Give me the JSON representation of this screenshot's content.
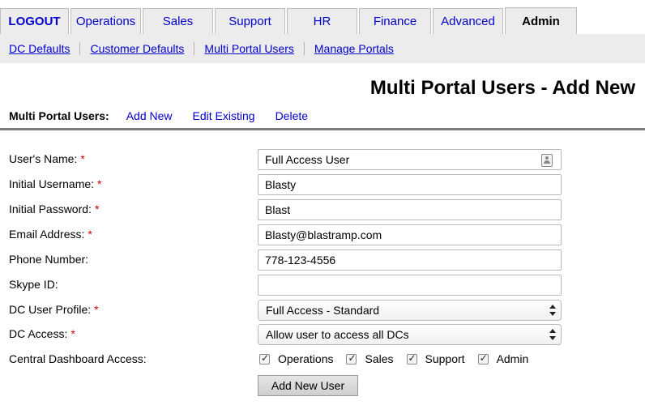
{
  "tabs": [
    {
      "label": "LOGOUT"
    },
    {
      "label": "Operations"
    },
    {
      "label": "Sales"
    },
    {
      "label": "Support"
    },
    {
      "label": "HR"
    },
    {
      "label": "Finance"
    },
    {
      "label": "Advanced"
    },
    {
      "label": "Admin",
      "active": true
    }
  ],
  "subnav": [
    {
      "label": "DC Defaults"
    },
    {
      "label": "Customer Defaults"
    },
    {
      "label": "Multi Portal Users"
    },
    {
      "label": "Manage Portals"
    }
  ],
  "page_title": "Multi Portal Users - Add New",
  "actionbar": {
    "label": "Multi Portal Users:",
    "links": [
      "Add New",
      "Edit Existing",
      "Delete"
    ]
  },
  "form": {
    "fields": [
      {
        "label": "User's Name:",
        "required": "*",
        "value": "Full Access User"
      },
      {
        "label": "Initial Username:",
        "required": "*",
        "value": "Blasty"
      },
      {
        "label": "Initial Password:",
        "required": "*",
        "value": "Blast"
      },
      {
        "label": "Email Address:",
        "required": "*",
        "value": "Blasty@blastramp.com"
      },
      {
        "label": "Phone Number:",
        "required": "",
        "value": "778-123-4556"
      },
      {
        "label": "Skype ID:",
        "required": "",
        "value": ""
      }
    ],
    "dc_user_profile": {
      "label": "DC User Profile:",
      "required": "*",
      "selected": "Full Access - Standard"
    },
    "dc_access": {
      "label": "DC Access:",
      "required": "*",
      "selected": "Allow user to access all DCs"
    },
    "dashboard_access": {
      "label": "Central Dashboard Access:",
      "options": [
        {
          "label": "Operations",
          "checked": true
        },
        {
          "label": "Sales",
          "checked": true
        },
        {
          "label": "Support",
          "checked": true
        },
        {
          "label": "Admin",
          "checked": true
        }
      ]
    },
    "submit_label": "Add New User"
  }
}
